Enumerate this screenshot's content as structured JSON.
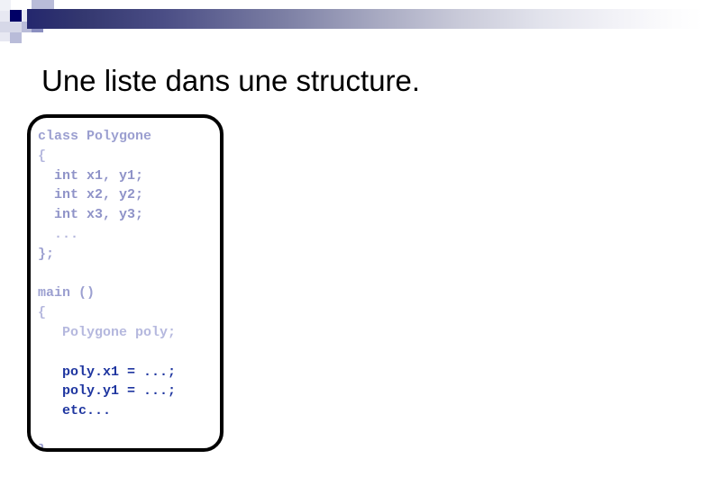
{
  "slide": {
    "title": "Une liste dans une structure.",
    "title_color": "#000000",
    "background_color": "#ffffff"
  },
  "header": {
    "gradient": {
      "from_color": "#24276e",
      "to_color": "#ffffff",
      "direction": "left-to-right"
    },
    "decoration_colors": {
      "navy": "#000066",
      "mid": "#8b8fc0",
      "light": "#b9bcd9",
      "pale": "#d6d8e8",
      "paler": "#e7e8f2",
      "faint": "#f0f1f7"
    }
  },
  "code_box": {
    "border_color": "#000000",
    "background_color": "#ffffff",
    "lines": [
      {
        "text": "class Polygone",
        "style": "c-lavender"
      },
      {
        "text": "{",
        "style": "c-pale"
      },
      {
        "text": "  int x1, y1;",
        "style": "c-mid"
      },
      {
        "text": "  int x2, y2;",
        "style": "c-mid"
      },
      {
        "text": "  int x3, y3;",
        "style": "c-mid"
      },
      {
        "text": "  ...",
        "style": "c-pale"
      },
      {
        "text": "};",
        "style": "c-lavender"
      },
      {
        "text": " ",
        "style": "c-blank"
      },
      {
        "text": "main ()",
        "style": "c-lavender"
      },
      {
        "text": "{",
        "style": "c-pale"
      },
      {
        "text": "   Polygone poly;",
        "style": "c-pale"
      },
      {
        "text": " ",
        "style": "c-blank"
      },
      {
        "text": "   poly.x1 = ...;",
        "style": "c-navy"
      },
      {
        "text": "   poly.y1 = ...;",
        "style": "c-navy"
      },
      {
        "text": "   etc...",
        "style": "c-navy"
      },
      {
        "text": " ",
        "style": "c-blank"
      },
      {
        "text": "}",
        "style": "c-lavender"
      }
    ]
  }
}
